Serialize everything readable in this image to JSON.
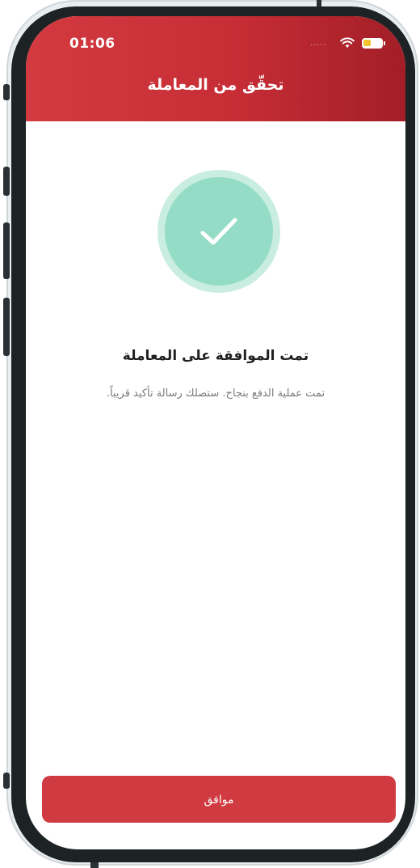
{
  "status_bar": {
    "time": "01:06",
    "signal_dots": "....."
  },
  "header": {
    "title": "تحقّق من المعاملة"
  },
  "result": {
    "title": "تمت الموافقة على المعاملة",
    "message": "تمت عملية الدفع بنجاح. ستصلك رسالة تأكيد قريباً."
  },
  "actions": {
    "ok_label": "موافق"
  },
  "colors": {
    "header_red": "#c72d35",
    "success_green": "#94dcc6",
    "button_red": "#d03a41"
  },
  "icons": {
    "status": [
      "wifi-icon",
      "battery-icon"
    ],
    "result": "checkmark-icon"
  }
}
